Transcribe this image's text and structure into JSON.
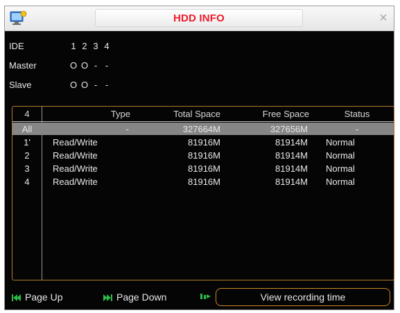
{
  "window": {
    "title": "HDD INFO",
    "close_glyph": "×",
    "title_color": "#ee1b2a",
    "accent_color": "#c8892a"
  },
  "ide": {
    "label": "IDE",
    "numbers": [
      "1",
      "2",
      "3",
      "4"
    ],
    "master": {
      "label": "Master",
      "values": [
        "O",
        "O",
        "-",
        "-"
      ]
    },
    "slave": {
      "label": "Slave",
      "values": [
        "O",
        "O",
        "-",
        "-"
      ]
    }
  },
  "table": {
    "headers": {
      "index": "4",
      "type": "Type",
      "total": "Total Space",
      "free": "Free Space",
      "status": "Status"
    },
    "rows": [
      {
        "index": "All",
        "type": "-",
        "total": "327664M",
        "free": "327656M",
        "status": "-"
      },
      {
        "index": "1'",
        "type": "Read/Write",
        "total": "81916M",
        "free": "81914M",
        "status": "Normal"
      },
      {
        "index": "2",
        "type": "Read/Write",
        "total": "81916M",
        "free": "81914M",
        "status": "Normal"
      },
      {
        "index": "3",
        "type": "Read/Write",
        "total": "81916M",
        "free": "81914M",
        "status": "Normal"
      },
      {
        "index": "4",
        "type": "Read/Write",
        "total": "81916M",
        "free": "81914M",
        "status": "Normal"
      }
    ]
  },
  "footer": {
    "page_up": "Page Up",
    "page_down": "Page Down",
    "view_recording_time": "View recording time"
  },
  "icons": {
    "app": "hdd-app-icon",
    "close": "close-icon",
    "page_up": "page-up-icon",
    "page_down": "page-down-icon",
    "view": "function-key-icon"
  }
}
